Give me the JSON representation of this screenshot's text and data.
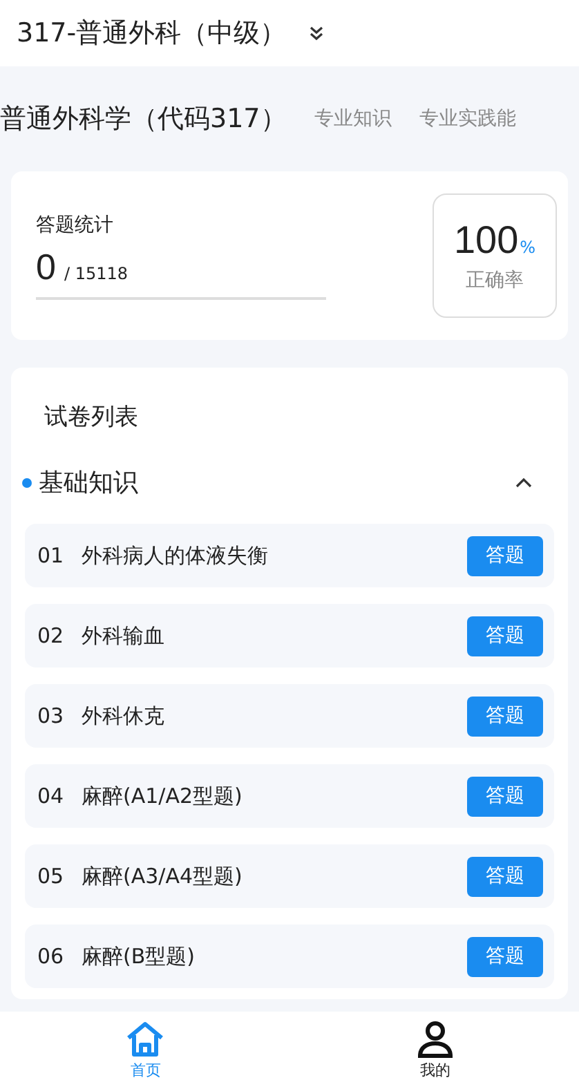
{
  "header": {
    "title": "317-普通外科（中级）"
  },
  "tabs": [
    {
      "label": "普通外科学（代码317）",
      "selected": true
    },
    {
      "label": "专业知识",
      "selected": false
    },
    {
      "label": "专业实践能",
      "selected": false
    }
  ],
  "stats": {
    "title": "答题统计",
    "answered": "0",
    "total": "/ 15118",
    "rate": "100",
    "rate_unit": "%",
    "rate_label": "正确率"
  },
  "paper_list": {
    "title": "试卷列表",
    "section": {
      "title": "基础知识",
      "expanded": true,
      "items": [
        {
          "number": "01",
          "name": "外科病人的体液失衡",
          "action": "答题"
        },
        {
          "number": "02",
          "name": "外科输血",
          "action": "答题"
        },
        {
          "number": "03",
          "name": "外科休克",
          "action": "答题"
        },
        {
          "number": "04",
          "name": "麻醉(A1/A2型题)",
          "action": "答题"
        },
        {
          "number": "05",
          "name": "麻醉(A3/A4型题)",
          "action": "答题"
        },
        {
          "number": "06",
          "name": "麻醉(B型题)",
          "action": "答题"
        }
      ]
    }
  },
  "bottom_nav": [
    {
      "kind": "home",
      "label": "首页",
      "selected": true
    },
    {
      "kind": "user",
      "label": "我的",
      "selected": false
    }
  ]
}
